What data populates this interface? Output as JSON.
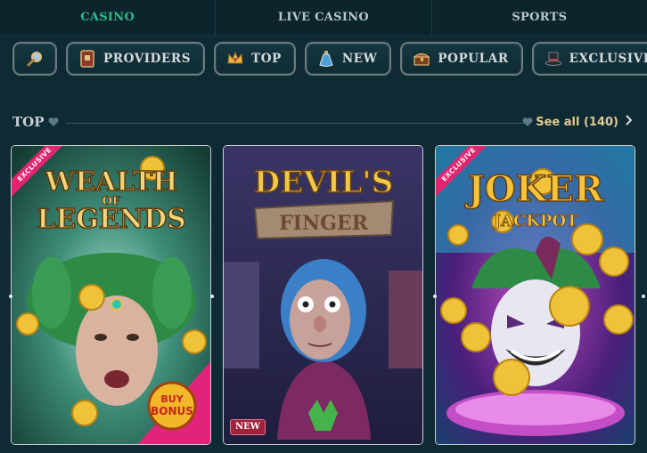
{
  "top_tabs": [
    {
      "label": "CASINO",
      "active": true
    },
    {
      "label": "LIVE CASINO",
      "active": false
    },
    {
      "label": "SPORTS",
      "active": false
    }
  ],
  "filters": {
    "search_icon": "search-icon",
    "items": [
      {
        "label": "PROVIDERS",
        "icon": "book-icon"
      },
      {
        "label": "TOP",
        "icon": "crown-icon"
      },
      {
        "label": "NEW",
        "icon": "potion-icon"
      },
      {
        "label": "POPULAR",
        "icon": "chest-icon"
      },
      {
        "label": "EXCLUSIVE",
        "icon": "top-hat-icon"
      }
    ]
  },
  "section": {
    "title": "TOP",
    "see_all": "See all (140)"
  },
  "games": [
    {
      "title_line1": "WEALTH",
      "title_line2": "OF",
      "title_line3": "LEGENDS",
      "ribbon": "EXCLUSIVE",
      "bonus": "BUY BONUS"
    },
    {
      "title_line1": "DEVIL'S",
      "title_line2": "FINGER",
      "badge": "NEW"
    },
    {
      "title_line1": "JOKER",
      "title_line2": "JACKPOT",
      "ribbon": "EXCLUSIVE"
    }
  ],
  "colors": {
    "active_tab": "#2fb98b",
    "see_all": "#e3c994",
    "ribbon": "#e3256f",
    "background": "#0e2a33"
  }
}
